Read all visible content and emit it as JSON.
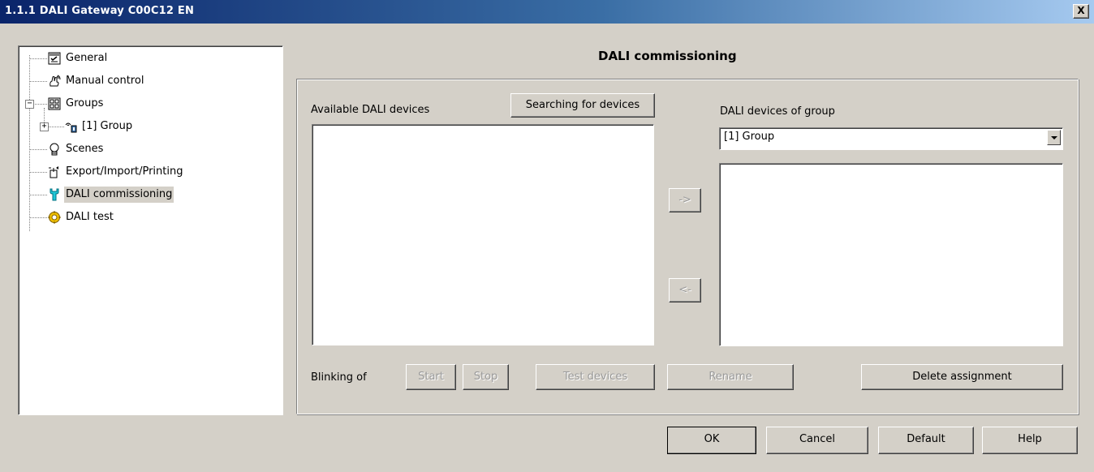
{
  "window": {
    "title": "1.1.1 DALI Gateway C00C12 EN",
    "close_label": "X"
  },
  "tree": {
    "items": [
      {
        "label": "General",
        "icon": "checklist-icon"
      },
      {
        "label": "Manual control",
        "icon": "hand-icon"
      },
      {
        "label": "Groups",
        "icon": "groups-icon"
      },
      {
        "label": "[1] Group",
        "icon": "group-lamp-icon"
      },
      {
        "label": "Scenes",
        "icon": "bulb-icon"
      },
      {
        "label": "Export/Import/Printing",
        "icon": "export-icon"
      },
      {
        "label": "DALI commissioning",
        "icon": "wrench-icon"
      },
      {
        "label": "DALI test",
        "icon": "gear-yellow-icon"
      }
    ],
    "expanders": {
      "groups": "−",
      "group1": "+"
    }
  },
  "main": {
    "heading": "DALI commissioning",
    "available_label": "Available DALI devices",
    "search_button": "Searching for devices",
    "group_label": "DALI devices of group",
    "group_select_value": "[1] Group",
    "move_right": "->",
    "move_left": "<-",
    "blinking_label": "Blinking of",
    "start_button": "Start",
    "stop_button": "Stop",
    "test_devices_button": "Test devices",
    "rename_button": "Rename",
    "delete_assignment_button": "Delete assignment"
  },
  "footer": {
    "ok": "OK",
    "cancel": "Cancel",
    "default": "Default",
    "help": "Help"
  }
}
